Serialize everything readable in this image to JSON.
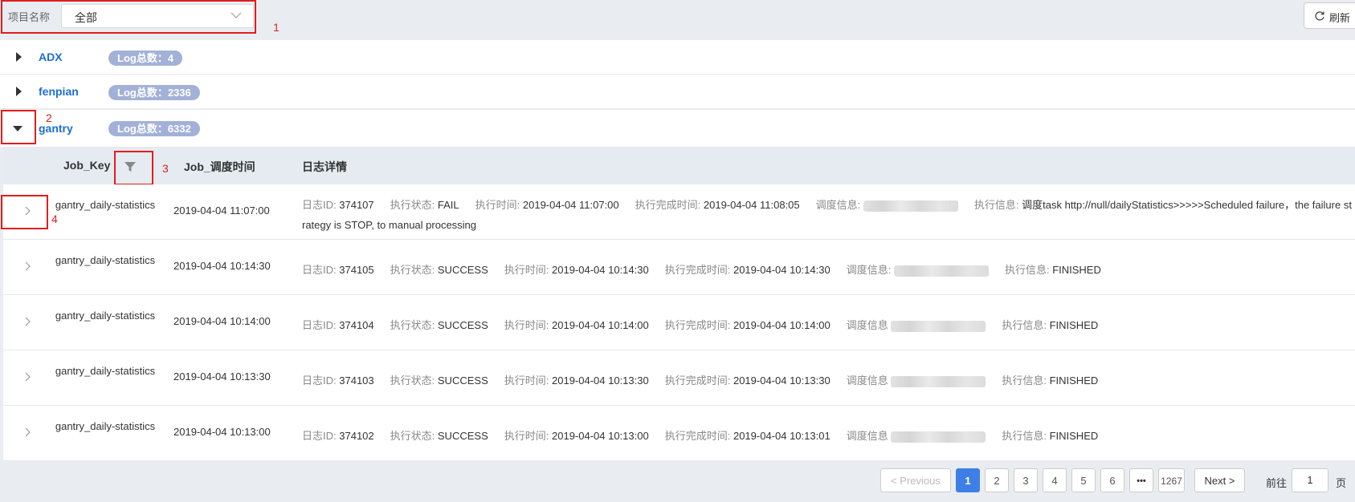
{
  "filter": {
    "label": "项目名称",
    "value": "全部"
  },
  "refresh_label": "刷新",
  "annotations": [
    "1",
    "2",
    "3",
    "4"
  ],
  "groups": [
    {
      "name": "ADX",
      "badge": "Log总数：4",
      "expanded": false
    },
    {
      "name": "fenpian",
      "badge": "Log总数：2336",
      "expanded": false
    },
    {
      "name": "gantry",
      "badge": "Log总数：6332",
      "expanded": true
    }
  ],
  "table": {
    "headers": [
      "Job_Key",
      "Job_调度时间",
      "日志详情"
    ],
    "detail_labels": {
      "log_id": "日志ID:",
      "status": "执行状态:",
      "exec_time": "执行时间:",
      "done_time": "执行完成时间:",
      "schedule": "调度信息:",
      "schedule_alt": "调度信息",
      "exec_info": "执行信息:"
    },
    "rows": [
      {
        "job_key": "gantry_daily-statistics",
        "time": "2019-04-04 11:07:00",
        "log_id": "374107",
        "status": "FAIL",
        "exec_time": "2019-04-04 11:07:00",
        "done_time": "2019-04-04 11:08:05",
        "exec_info": "调度task http://null/dailyStatistics>>>>>Scheduled failure，the failure strategy is STOP, to manual processing"
      },
      {
        "job_key": "gantry_daily-statistics",
        "time": "2019-04-04 10:14:30",
        "log_id": "374105",
        "status": "SUCCESS",
        "exec_time": "2019-04-04 10:14:30",
        "done_time": "2019-04-04 10:14:30",
        "exec_info": "FINISHED"
      },
      {
        "job_key": "gantry_daily-statistics",
        "time": "2019-04-04 10:14:00",
        "log_id": "374104",
        "status": "SUCCESS",
        "exec_time": "2019-04-04 10:14:00",
        "done_time": "2019-04-04 10:14:00",
        "exec_info": "FINISHED"
      },
      {
        "job_key": "gantry_daily-statistics",
        "time": "2019-04-04 10:13:30",
        "log_id": "374103",
        "status": "SUCCESS",
        "exec_time": "2019-04-04 10:13:30",
        "done_time": "2019-04-04 10:13:30",
        "exec_info": "FINISHED"
      },
      {
        "job_key": "gantry_daily-statistics",
        "time": "2019-04-04 10:13:00",
        "log_id": "374102",
        "status": "SUCCESS",
        "exec_time": "2019-04-04 10:13:00",
        "done_time": "2019-04-04 10:13:01",
        "exec_info": "FINISHED"
      }
    ]
  },
  "pagination": {
    "previous": "< Previous",
    "pages": [
      "1",
      "2",
      "3",
      "4",
      "5",
      "6"
    ],
    "ellipsis": "•••",
    "last": "1267",
    "next": "Next >",
    "goto_prefix": "前往",
    "goto_value": "1",
    "goto_suffix": "页"
  },
  "colors": {
    "link": "#1a6fd6",
    "badge": "#a3b1d8",
    "active_page": "#3d7fe6",
    "annotation": "#e01e1e"
  }
}
